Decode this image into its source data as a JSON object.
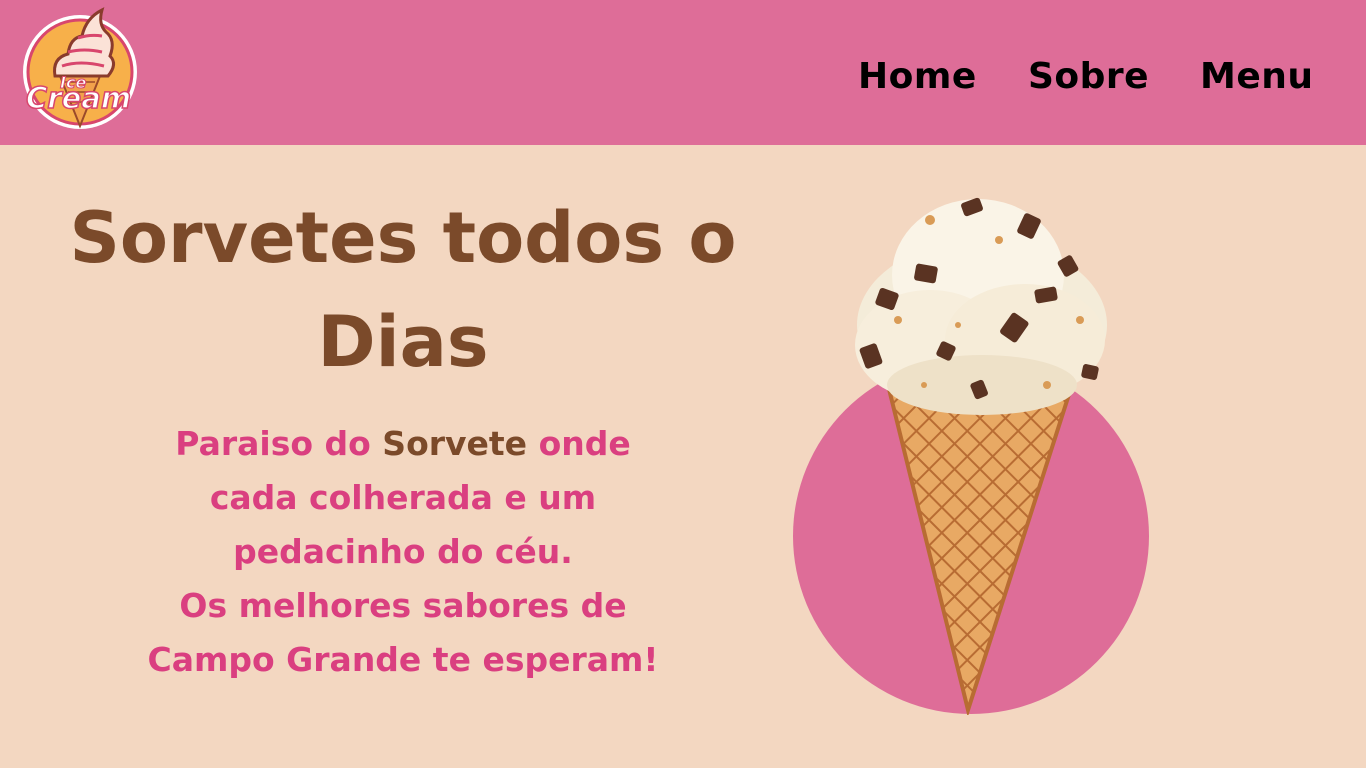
{
  "brand": {
    "logo_text_top": "Ice",
    "logo_text_bottom": "Cream"
  },
  "nav": {
    "home": "Home",
    "sobre": "Sobre",
    "menu": "Menu"
  },
  "hero": {
    "title_line1": "Sorvetes todos o",
    "title_line2": "Dias",
    "text_brand": "Paraiso do",
    "text_highlight": "Sorvete",
    "text_line1_end": "onde",
    "text_line2": "cada colherada e um",
    "text_line3": "pedacinho do céu.",
    "text_line4": "Os melhores sabores de",
    "text_line5": "Campo Grande te esperam!"
  },
  "colors": {
    "header_bg": "#de6d98",
    "page_bg": "#f3d7c1",
    "title": "#7b4a2a",
    "accent_text": "#da3f80",
    "circle": "#de6d98"
  }
}
